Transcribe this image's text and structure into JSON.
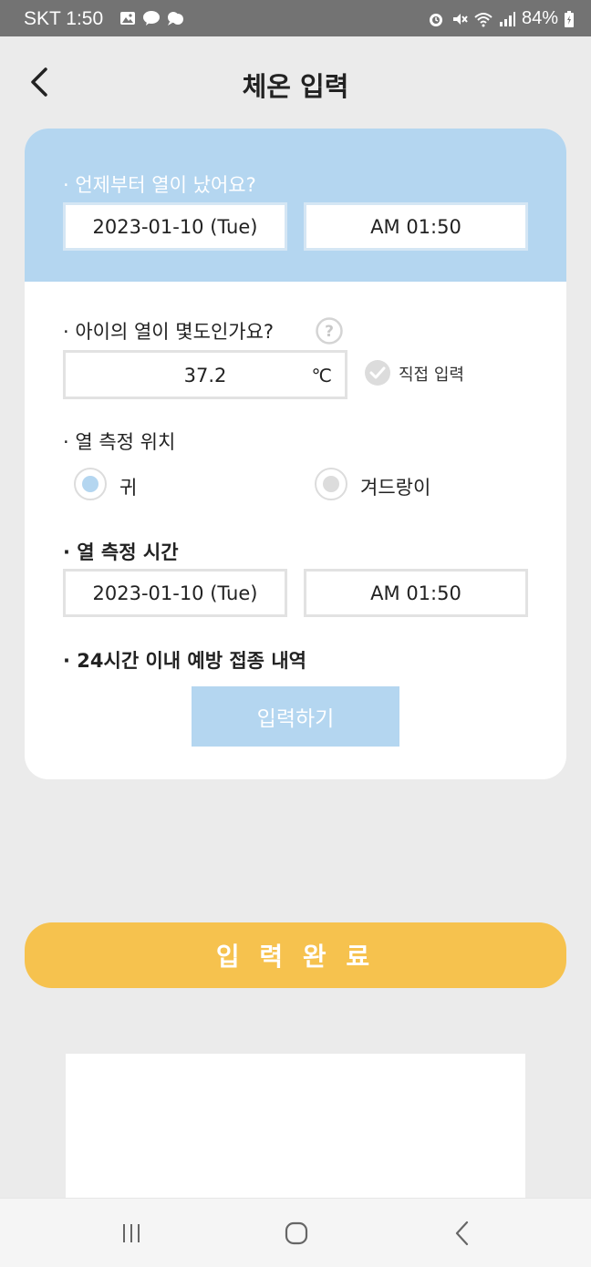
{
  "status_bar": {
    "carrier_time": "SKT 1:50",
    "battery": "84%",
    "left_icons": [
      "gallery-icon",
      "kakaotalk-icon",
      "chat-bubble-icon"
    ],
    "right_icons": [
      "alarm-icon",
      "mute-icon",
      "wifi-icon",
      "signal-icon",
      "battery-icon"
    ]
  },
  "header": {
    "title": "체온 입력",
    "back_icon": "chevron-left-icon"
  },
  "card": {
    "fever_start": {
      "label": "· 언제부터 열이 났어요?",
      "date": "2023-01-10 (Tue)",
      "time": "AM 01:50"
    },
    "temperature": {
      "label": "· 아이의 열이 몇도인가요?",
      "value": "37.2",
      "unit": "℃",
      "direct_input_label": "직접 입력"
    },
    "location": {
      "label": "· 열 측정 위치",
      "options": [
        {
          "label": "귀",
          "selected": true
        },
        {
          "label": "겨드랑이",
          "selected": false
        }
      ]
    },
    "measure_time": {
      "label": "· 열 측정 시간",
      "date": "2023-01-10 (Tue)",
      "time": "AM 01:50"
    },
    "vaccination": {
      "label": "· 24시간 이내 예방 접종 내역",
      "button_label": "입력하기"
    }
  },
  "complete_button": "입 력 완 료",
  "colors": {
    "accent_blue": "#b4d6f0",
    "complete_yellow": "#f6c24e",
    "background": "#ebebeb"
  }
}
